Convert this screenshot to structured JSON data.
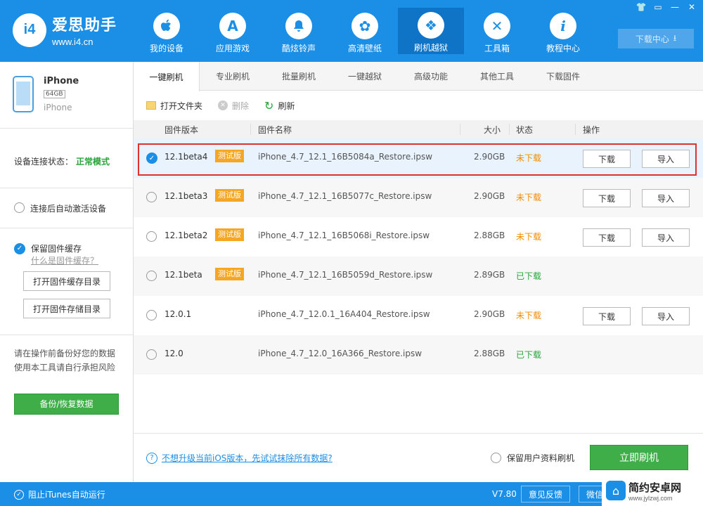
{
  "app": {
    "logo_mark": "i4",
    "logo_title": "爱思助手",
    "logo_url": "www.i4.cn"
  },
  "nav": [
    {
      "label": "我的设备",
      "icon": "apple-icon",
      "glyph": ""
    },
    {
      "label": "应用游戏",
      "icon": "app-store-icon",
      "glyph": "A"
    },
    {
      "label": "酷炫铃声",
      "icon": "bell-icon",
      "glyph": "🔔"
    },
    {
      "label": "高清壁纸",
      "icon": "flower-icon",
      "glyph": "✿"
    },
    {
      "label": "刷机越狱",
      "icon": "dropbox-icon",
      "glyph": "❖"
    },
    {
      "label": "工具箱",
      "icon": "tools-icon",
      "glyph": "✕"
    },
    {
      "label": "教程中心",
      "icon": "info-icon",
      "glyph": "i"
    }
  ],
  "header": {
    "download_center": "下载中心",
    "window_controls": [
      "👕",
      "▭",
      "—",
      "✕"
    ]
  },
  "sidebar": {
    "device_name": "iPhone",
    "device_capacity": "64GB",
    "device_type": "iPhone",
    "conn_label": "设备连接状态：",
    "conn_value": "正常模式",
    "auto_activate": "连接后自动激活设备",
    "keep_cache": "保留固件缓存",
    "cache_link": "什么是固件缓存？",
    "open_cache_dir": "打开固件缓存目录",
    "open_storage_dir": "打开固件存储目录",
    "risk_line1": "请在操作前备份好您的数据",
    "risk_line2": "使用本工具请自行承担风险",
    "backup_button": "备份/恢复数据"
  },
  "tabs": [
    "一键刷机",
    "专业刷机",
    "批量刷机",
    "一键越狱",
    "高级功能",
    "其他工具",
    "下载固件"
  ],
  "toolbar": {
    "open_folder": "打开文件夹",
    "delete": "删除",
    "refresh": "刷新"
  },
  "table": {
    "headers": {
      "version": "固件版本",
      "name": "固件名称",
      "size": "大小",
      "status": "状态",
      "action": "操作"
    },
    "rows": [
      {
        "version": "12.1beta4",
        "tag": "测试版",
        "name": "iPhone_4.7_12.1_16B5084a_Restore.ipsw",
        "size": "2.90GB",
        "status": "未下载",
        "download": "下载",
        "import": "导入"
      },
      {
        "version": "12.1beta3",
        "tag": "测试版",
        "name": "iPhone_4.7_12.1_16B5077c_Restore.ipsw",
        "size": "2.90GB",
        "status": "未下载",
        "download": "下载",
        "import": "导入"
      },
      {
        "version": "12.1beta2",
        "tag": "测试版",
        "name": "iPhone_4.7_12.1_16B5068i_Restore.ipsw",
        "size": "2.88GB",
        "status": "未下载",
        "download": "下载",
        "import": "导入"
      },
      {
        "version": "12.1beta",
        "tag": "测试版",
        "name": "iPhone_4.7_12.1_16B5059d_Restore.ipsw",
        "size": "2.89GB",
        "status": "已下载"
      },
      {
        "version": "12.0.1",
        "name": "iPhone_4.7_12.0.1_16A404_Restore.ipsw",
        "size": "2.90GB",
        "status": "未下载",
        "download": "下载",
        "import": "导入"
      },
      {
        "version": "12.0",
        "name": "iPhone_4.7_12.0_16A366_Restore.ipsw",
        "size": "2.88GB",
        "status": "已下载"
      }
    ]
  },
  "bottom": {
    "help_link": "不想升级当前iOS版本，先试试抹除所有数据?",
    "keep_user_data": "保留用户资料刷机",
    "flash_now": "立即刷机"
  },
  "statusbar": {
    "block_itunes": "阻止iTunes自动运行",
    "version": "V7.80",
    "feedback": "意见反馈",
    "wechat": "微信"
  },
  "watermark": {
    "title": "简约安卓网",
    "url": "www.jylzwj.com"
  }
}
